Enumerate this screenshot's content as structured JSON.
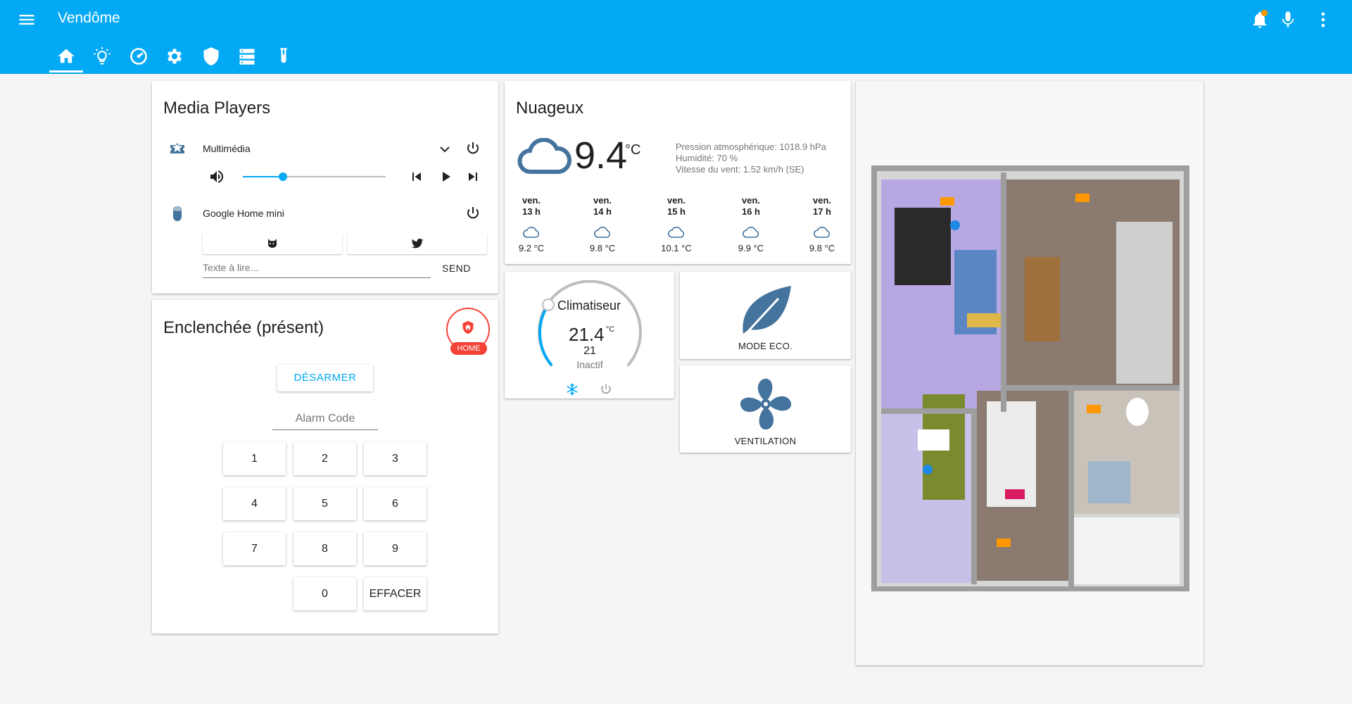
{
  "app": {
    "title": "Vendôme",
    "tabs": [
      "home-icon",
      "lightbulb-icon",
      "gauge-icon",
      "settings-icon",
      "shield-icon",
      "server-icon",
      "flask-icon"
    ],
    "header_icons": [
      "menu-icon",
      "bell-icon",
      "microphone-icon",
      "more-vert-icon"
    ],
    "accent_color": "#03a9f4"
  },
  "media_players": {
    "title": "Media Players",
    "players": [
      {
        "name": "Multimédia",
        "icon": "ticket-icon",
        "volume_fraction": 0.28
      },
      {
        "name": "Google Home mini",
        "icon": "speaker-icon"
      }
    ],
    "tts_placeholder": "Texte à lire...",
    "send_label": "SEND"
  },
  "alarm": {
    "title": "Enclenchée (présent)",
    "badge": "HOME",
    "disarm_label": "DÉSARMER",
    "code_placeholder": "Alarm Code",
    "keys": [
      "1",
      "2",
      "3",
      "4",
      "5",
      "6",
      "7",
      "8",
      "9",
      "0",
      "EFFACER"
    ],
    "status_color": "#f44336"
  },
  "weather": {
    "condition": "Nuageux",
    "temperature": "9.4",
    "unit": "°C",
    "pressure": "Pression atmosphérique: 1018.9 hPa",
    "humidity": "Humidité: 70 %",
    "wind": "Vitesse du vent: 1.52 km/h (SE)",
    "forecast": [
      {
        "day": "ven.",
        "hour": "13 h",
        "temp": "9.2 °C"
      },
      {
        "day": "ven.",
        "hour": "14 h",
        "temp": "9.8 °C"
      },
      {
        "day": "ven.",
        "hour": "15 h",
        "temp": "10.1 °C"
      },
      {
        "day": "ven.",
        "hour": "16 h",
        "temp": "9.9 °C"
      },
      {
        "day": "ven.",
        "hour": "17 h",
        "temp": "9.8 °C"
      }
    ]
  },
  "thermostat": {
    "name": "Climatiseur",
    "current": "21.4",
    "unit": "°C",
    "target": "21",
    "state": "Inactif"
  },
  "entity_buttons": [
    {
      "label": "MODE ECO.",
      "icon": "leaf-icon",
      "color": "#44739e"
    },
    {
      "label": "VENTILATION",
      "icon": "fan-icon",
      "color": "#44739e"
    }
  ],
  "floorplan": {
    "icon_color": "#ff9800"
  }
}
